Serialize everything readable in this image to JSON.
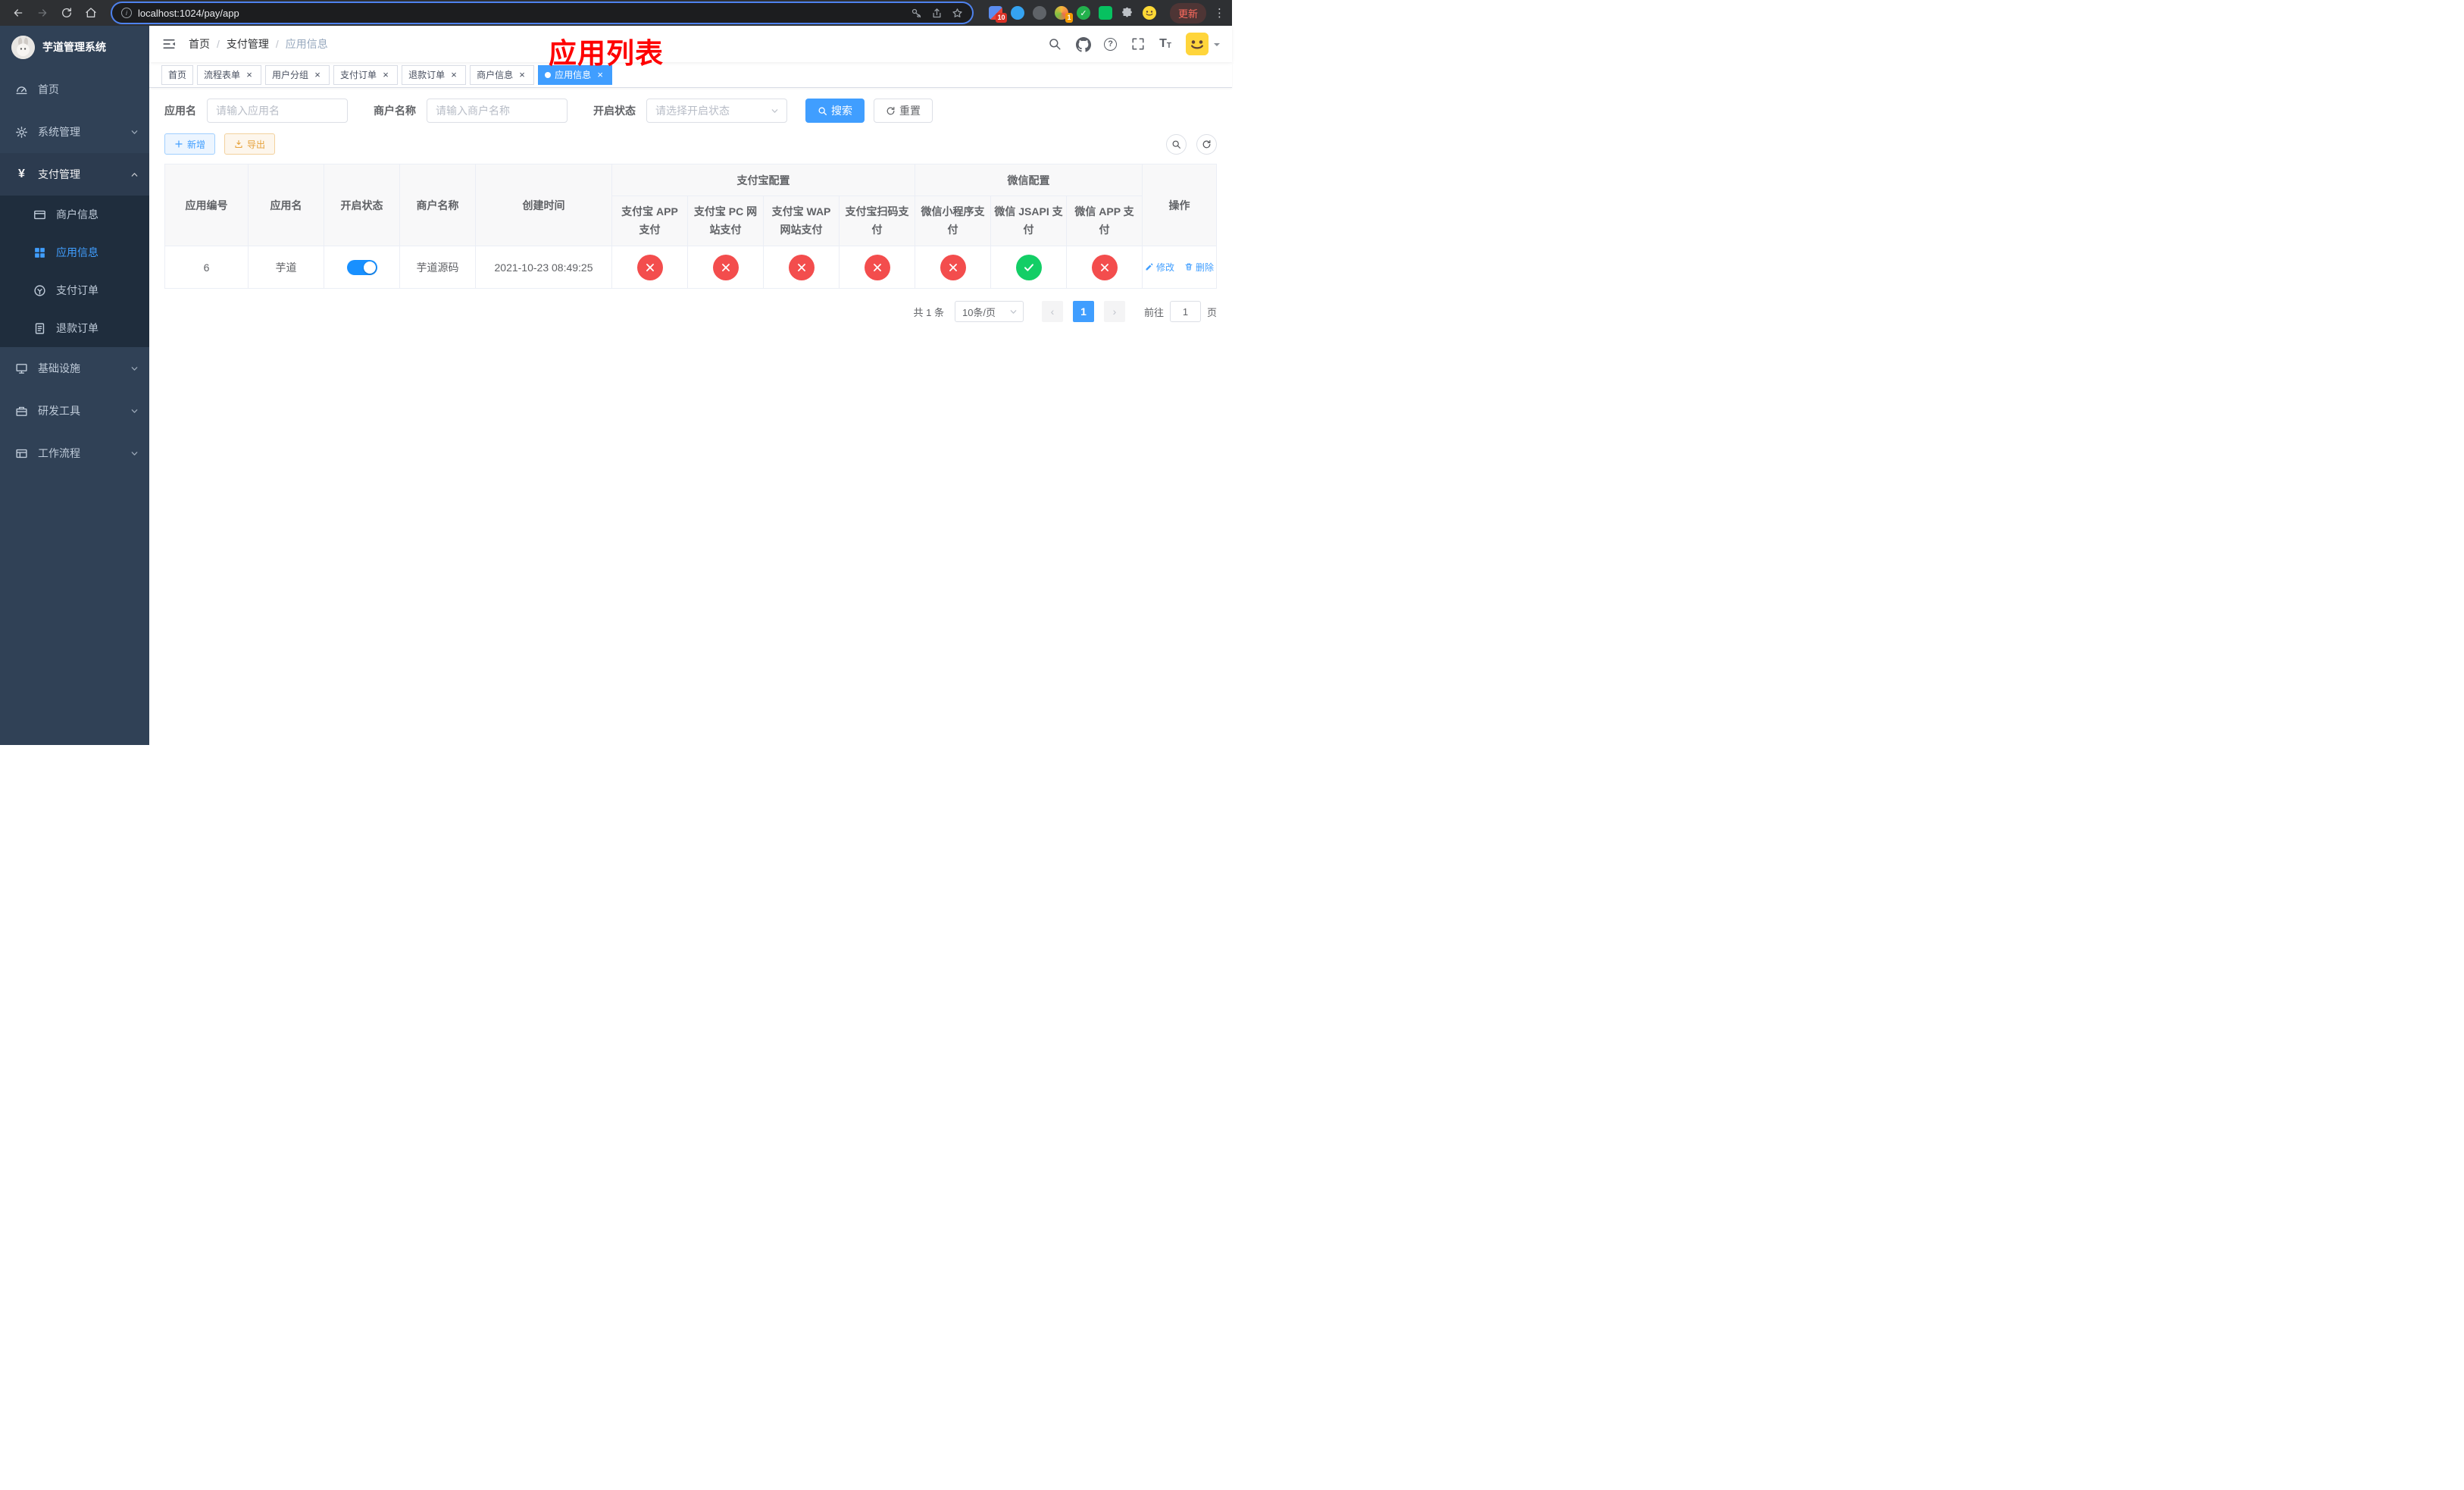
{
  "annotation": {
    "text": "应用列表"
  },
  "colors": {
    "accent": "#409EFF",
    "success": "#13CE66",
    "danger": "#F34D4D",
    "annotation_red": "#FE0000",
    "sidebar_bg": "#304156",
    "submenu_bg": "#1F2D3D"
  },
  "browser": {
    "url": "localhost:1024/pay/app",
    "update_label": "更新",
    "ext_badge_1": "10",
    "ext_badge_2": "1"
  },
  "sidebar": {
    "title": "芋道管理系统",
    "items": [
      {
        "label": "首页",
        "icon": "dashboard-icon"
      },
      {
        "label": "系统管理",
        "icon": "gear-icon"
      },
      {
        "label": "支付管理",
        "icon": "yen-icon"
      },
      {
        "label": "基础设施",
        "icon": "monitor-icon"
      },
      {
        "label": "研发工具",
        "icon": "toolbox-icon"
      },
      {
        "label": "工作流程",
        "icon": "workflow-icon"
      }
    ],
    "payment_submenu": [
      {
        "label": "商户信息",
        "icon": "card-icon"
      },
      {
        "label": "应用信息",
        "icon": "grid-icon"
      },
      {
        "label": "支付订单",
        "icon": "pay-order-icon"
      },
      {
        "label": "退款订单",
        "icon": "refund-icon"
      }
    ]
  },
  "header": {
    "breadcrumb": [
      "首页",
      "支付管理",
      "应用信息"
    ]
  },
  "tabs": [
    {
      "label": "首页"
    },
    {
      "label": "流程表单"
    },
    {
      "label": "用户分组"
    },
    {
      "label": "支付订单"
    },
    {
      "label": "退款订单"
    },
    {
      "label": "商户信息"
    },
    {
      "label": "应用信息"
    }
  ],
  "filters": {
    "app_name_label": "应用名",
    "app_name_placeholder": "请输入应用名",
    "merchant_label": "商户名称",
    "merchant_placeholder": "请输入商户名称",
    "status_label": "开启状态",
    "status_placeholder": "请选择开启状态",
    "search_label": "搜索",
    "reset_label": "重置"
  },
  "toolbar": {
    "add_label": "新增",
    "export_label": "导出"
  },
  "table": {
    "plain_columns": [
      "应用编号",
      "应用名",
      "开启状态",
      "商户名称",
      "创建时间"
    ],
    "alipay_group_label": "支付宝配置",
    "wechat_group_label": "微信配置",
    "sub_columns": [
      "支付宝 APP 支付",
      "支付宝 PC 网站支付",
      "支付宝 WAP 网站支付",
      "支付宝扫码支付",
      "微信小程序支付",
      "微信 JSAPI 支付",
      "微信 APP 支付"
    ],
    "ops_label": "操作",
    "row": {
      "id": "6",
      "name": "芋道",
      "status_enabled": true,
      "merchant_name": "芋道源码",
      "create_time": "2021-10-23 08:49:25",
      "configs": [
        false,
        false,
        false,
        false,
        false,
        true,
        false
      ],
      "edit_label": "修改",
      "delete_label": "删除"
    }
  },
  "pagination": {
    "total_text": "共 1 条",
    "page_size_text": "10条/页",
    "current_page": "1",
    "goto_label": "前往",
    "goto_value": "1",
    "goto_suffix": "页"
  }
}
